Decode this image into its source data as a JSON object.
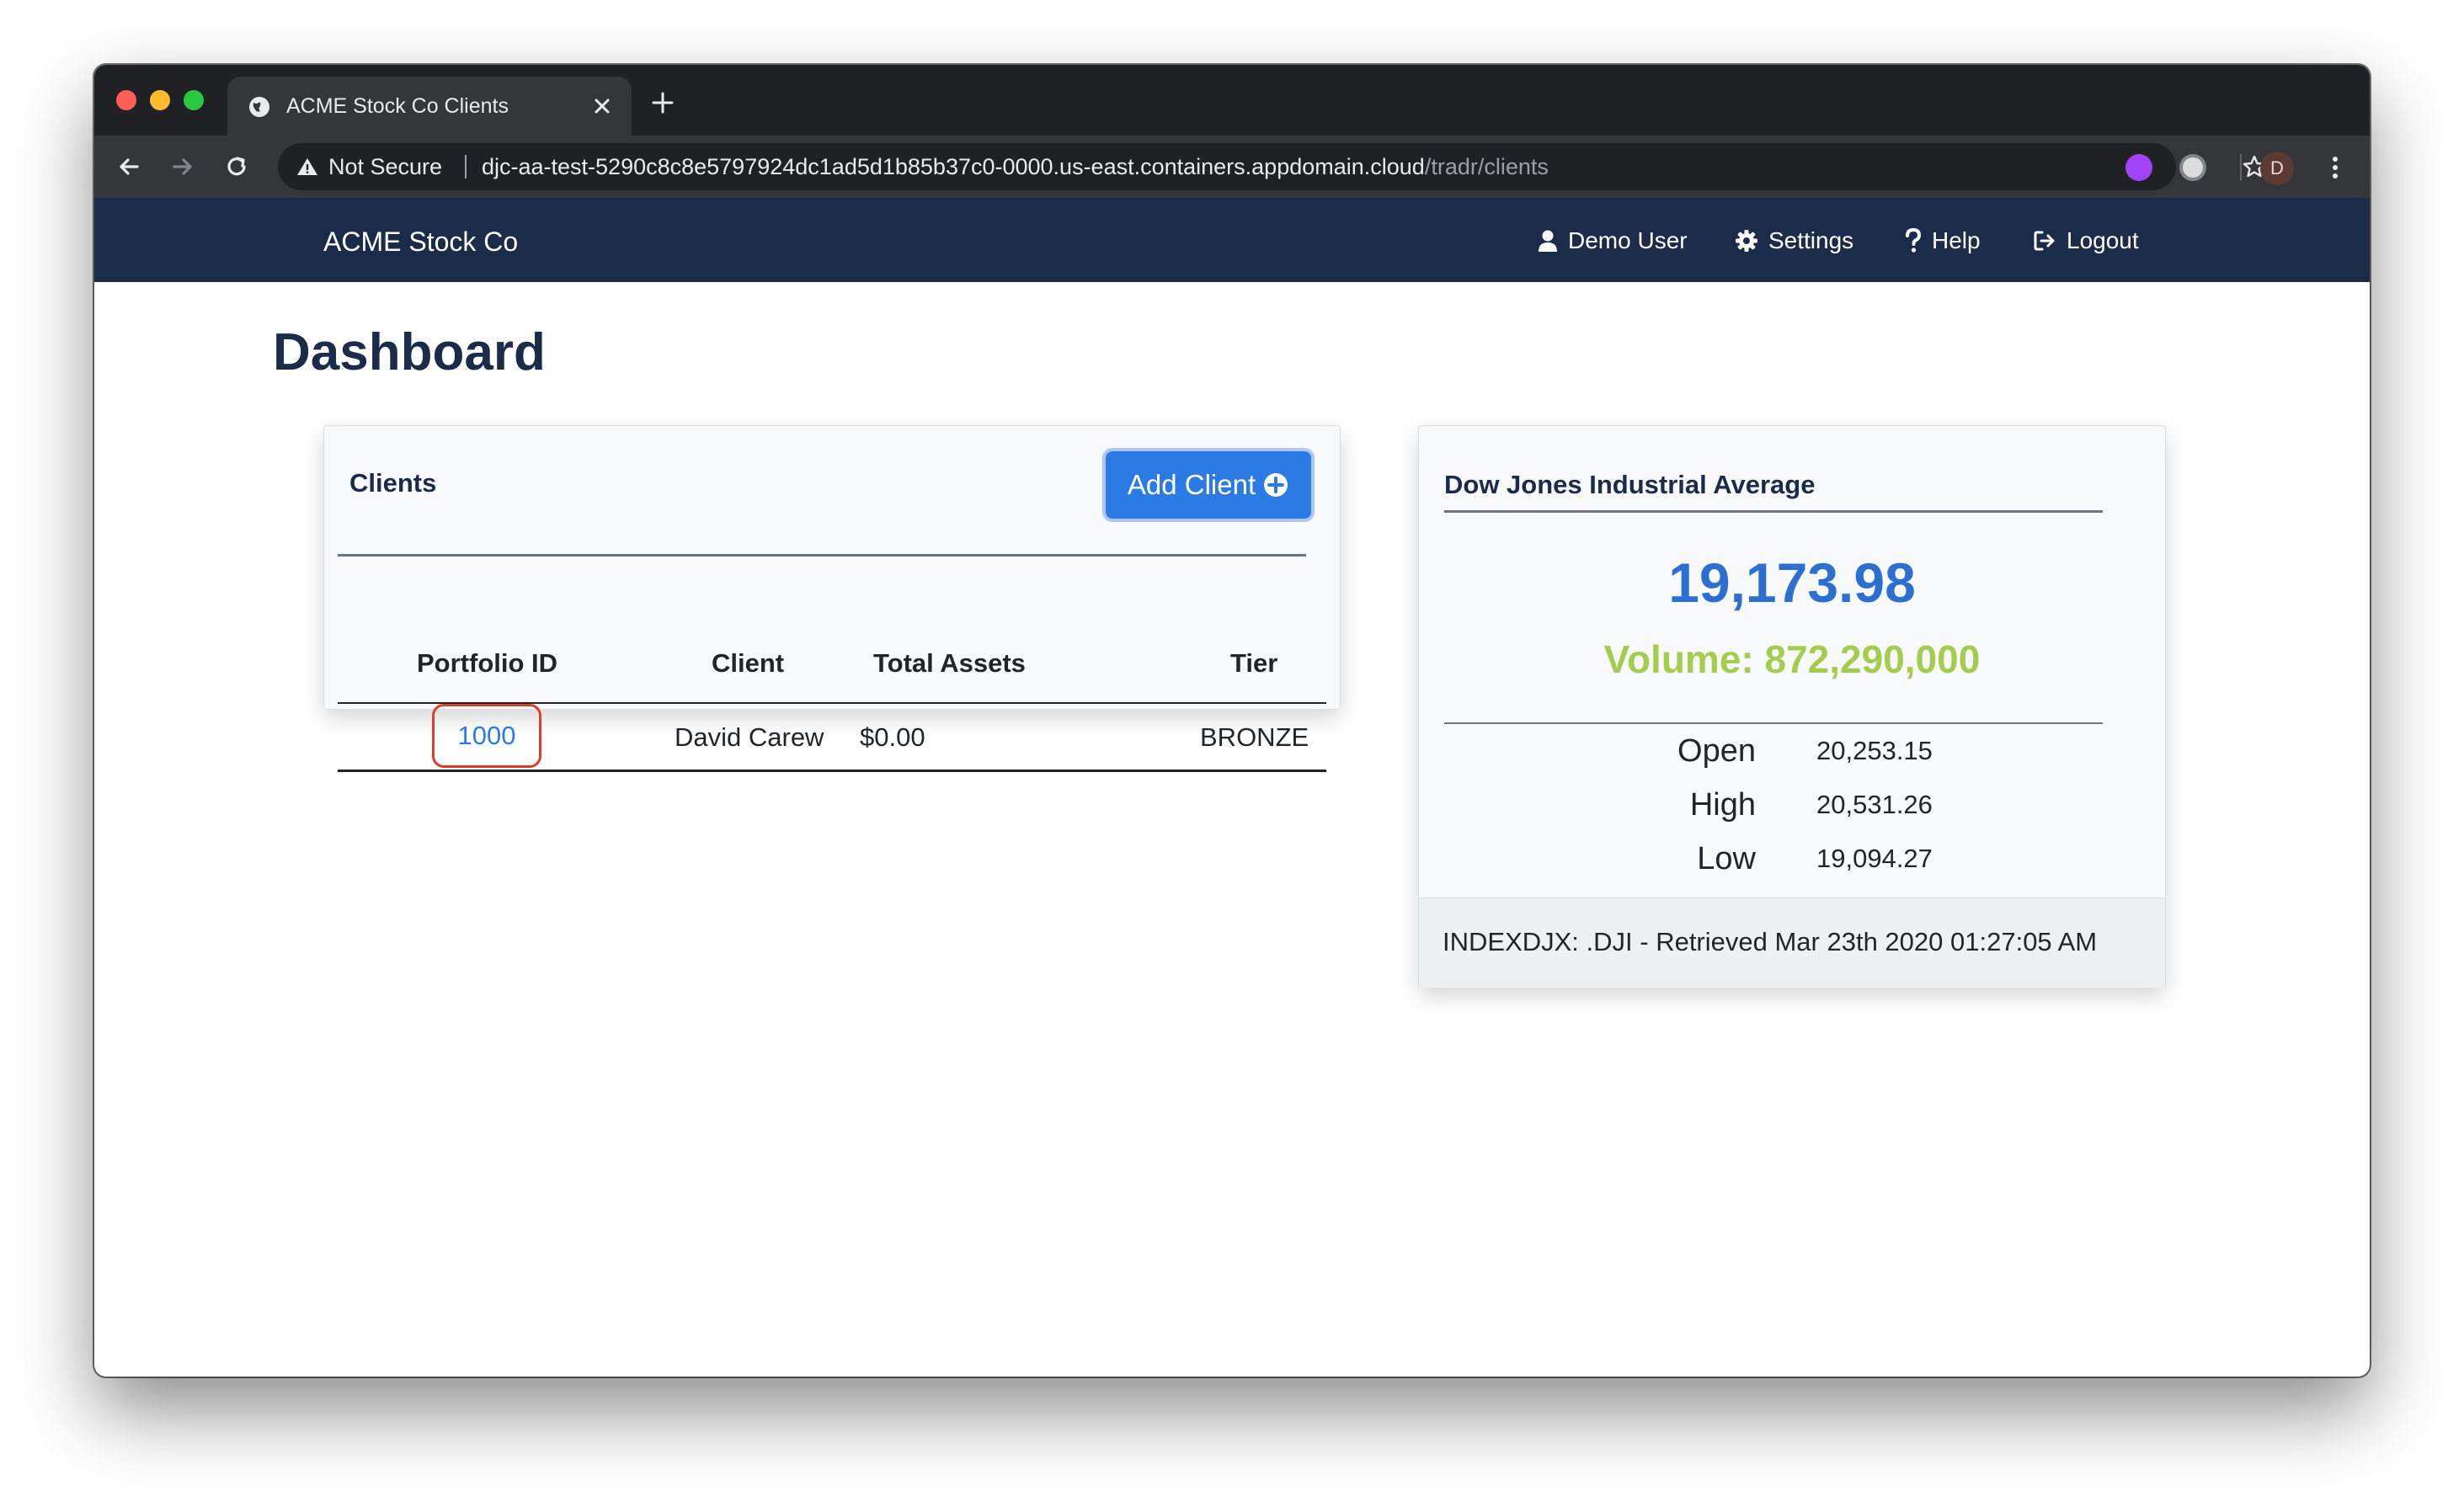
{
  "browser": {
    "tab_title": "ACME Stock Co Clients",
    "security_label": "Not Secure",
    "url_host": "djc-aa-test-5290c8c8e5797924dc1ad5d1b85b37c0-0000.us-east.containers.appdomain.cloud",
    "url_path": "/tradr/clients",
    "profile_initial": "D"
  },
  "nav": {
    "brand": "ACME Stock Co",
    "user": "Demo User",
    "settings": "Settings",
    "help": "Help",
    "logout": "Logout"
  },
  "page": {
    "title": "Dashboard"
  },
  "clients": {
    "title": "Clients",
    "add_button": "Add Client",
    "columns": [
      "Portfolio ID",
      "Client",
      "Total Assets",
      "Tier"
    ],
    "rows": [
      {
        "portfolio_id": "1000",
        "client": "David Carew",
        "total_assets": "$0.00",
        "tier": "BRONZE"
      }
    ]
  },
  "dow": {
    "title": "Dow Jones Industrial Average",
    "price": "19,173.98",
    "volume": "Volume: 872,290,000",
    "stats": [
      {
        "label": "Open",
        "value": "20,253.15"
      },
      {
        "label": "High",
        "value": "20,531.26"
      },
      {
        "label": "Low",
        "value": "19,094.27"
      }
    ],
    "footer": "INDEXDJX: .DJI - Retrieved Mar 23th 2020 01:27:05 AM"
  },
  "colors": {
    "navbar": "#1b2b4a",
    "accent": "#2c7be5",
    "price": "#2c6fd1",
    "volume": "#a4cd4f",
    "highlight": "#d9402b"
  },
  "icons": [
    "globe-icon",
    "close-icon",
    "plus-icon",
    "back-icon",
    "forward-icon",
    "reload-icon",
    "warning-icon",
    "star-icon",
    "user-icon",
    "gear-icon",
    "question-icon",
    "logout-icon",
    "plus-circle-icon"
  ]
}
